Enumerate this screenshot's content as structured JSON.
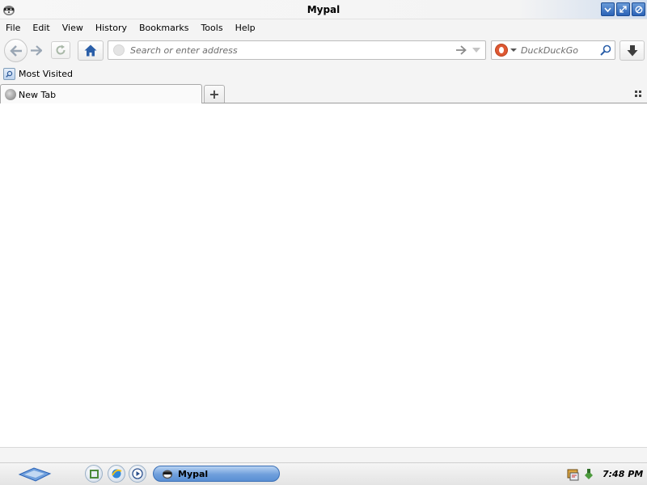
{
  "window": {
    "title": "Mypal",
    "controls": [
      "minimize",
      "restore",
      "close"
    ]
  },
  "menu": {
    "items": [
      "File",
      "Edit",
      "View",
      "History",
      "Bookmarks",
      "Tools",
      "Help"
    ]
  },
  "navbar": {
    "icons": [
      "back-icon",
      "forward-icon",
      "reload-icon",
      "home-icon",
      "go-arrow-icon",
      "download-icon"
    ],
    "url_placeholder": "Search or enter address",
    "search_engine": "DuckDuckGo",
    "search_placeholder": "DuckDuckGo"
  },
  "bookmarks": {
    "items": [
      {
        "label": "Most Visited"
      }
    ]
  },
  "tabs": {
    "items": [
      {
        "label": "New Tab"
      }
    ],
    "new_tab_symbol": "+"
  },
  "taskbar": {
    "task_label": "Mypal",
    "clock": "7:48 PM"
  },
  "colors": {
    "titlebar": "#f4f4f4",
    "window_button": "#2b63b7",
    "taskbar_task": "#6f9fdc"
  }
}
